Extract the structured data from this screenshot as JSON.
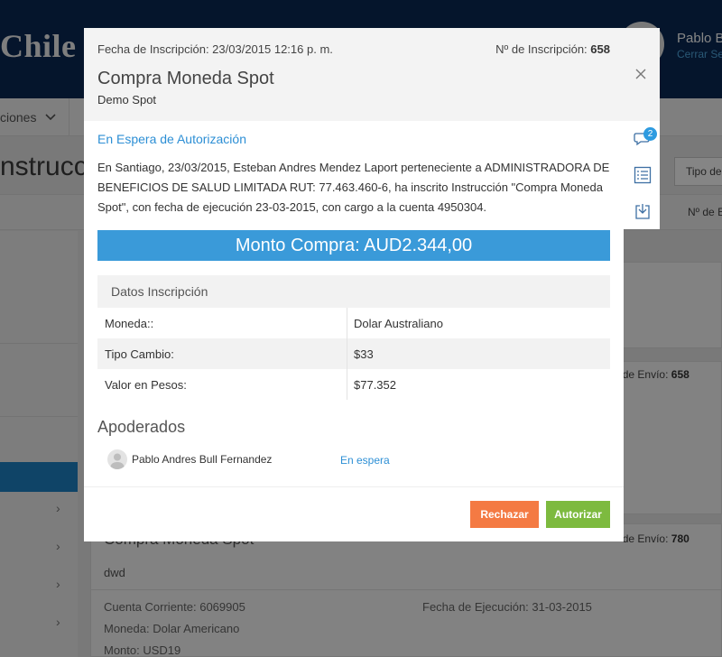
{
  "app": {
    "logo": "Chile",
    "user_name": "Pablo B",
    "logout_label": "Cerrar Se",
    "nav_item": "ciones",
    "page_title": "nstrucc",
    "filter_placeholder": "Tipo de",
    "column_header": "Nº de E"
  },
  "background_cards": {
    "envio_label": "º de Envío:",
    "card1_envio_number": "658",
    "card2_envio_number": "780",
    "card2_title": "Compra Moneda Spot",
    "card2_sub": "dwd",
    "card2_cuenta": "Cuenta Corriente: 6069905",
    "card2_moneda": "Moneda: Dolar Americano",
    "card2_monto": "Monto: USD19",
    "card2_fecha": "Fecha de Ejecución: 31-03-2015"
  },
  "modal": {
    "date_label": "Fecha de Inscripción: 23/03/2015 12:16 p. m.",
    "inscription_label": "Nº de Inscripción:",
    "inscription_number": "658",
    "title": "Compra Moneda Spot",
    "subtitle": "Demo Spot",
    "status": "En Espera de Autorización",
    "description": "En Santiago, 23/03/2015, Esteban Andres Mendez Laport perteneciente a ADMINISTRADORA DE BENEFICIOS DE SALUD LIMITADA RUT: 77.463.460-6, ha inscrito Instrucción \"Compra Moneda Spot\", con fecha de ejecución 23-03-2015, con cargo a la cuenta 4950304.",
    "amount_banner": "Monto Compra: AUD2.344,00",
    "table_title": "Datos Inscripción",
    "rows": [
      {
        "label": "Moneda::",
        "value": "Dolar Australiano"
      },
      {
        "label": "Tipo Cambio:",
        "value": "$33"
      },
      {
        "label": "Valor en Pesos:",
        "value": "$77.352"
      }
    ],
    "apoderados_title": "Apoderados",
    "apoderado_name": "Pablo Andres Bull Fernandez",
    "apoderado_status": "En espera",
    "reject_label": "Rechazar",
    "authorize_label": "Autorizar"
  },
  "tools": {
    "comments_badge": "2",
    "icons": [
      "close-icon",
      "comments-icon",
      "list-icon",
      "download-icon"
    ]
  },
  "colors": {
    "navy": "#0a2a55",
    "accent_blue": "#3a9ad9",
    "link_blue": "#2d8fd5",
    "reject_orange": "#f47a43",
    "authorize_green": "#7dba3f"
  }
}
